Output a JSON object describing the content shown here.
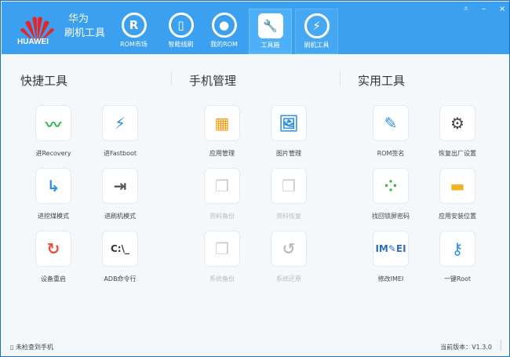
{
  "app": {
    "logo_text": "HUAWEI",
    "brand_line1": "华为",
    "brand_line2": "刷机工具"
  },
  "nav": [
    {
      "label": "ROM市场",
      "icon": "R"
    },
    {
      "label": "智能线刷",
      "icon": "▯"
    },
    {
      "label": "我的ROM",
      "icon": "●"
    },
    {
      "label": "工具箱",
      "icon": "🔧"
    },
    {
      "label": "刷机工具",
      "icon": "⚡"
    }
  ],
  "controls": {
    "menu": "⩡",
    "minimize": "–",
    "close": "×"
  },
  "sections": [
    {
      "title": "快捷工具",
      "items": [
        {
          "label": "进Recovery",
          "icon": "〰",
          "color": "#2ab54a"
        },
        {
          "label": "进Fastboot",
          "icon": "⚡",
          "color": "#2f8fe6"
        },
        {
          "label": "进挖煤模式",
          "icon": "↳",
          "color": "#2f8fe6"
        },
        {
          "label": "进刷机模式",
          "icon": "⇥",
          "color": "#555555"
        },
        {
          "label": "设备重启",
          "icon": "↻",
          "color": "#e8503a"
        },
        {
          "label": "ADB命令行",
          "icon": "C:\\_",
          "color": "#333333"
        }
      ]
    },
    {
      "title": "手机管理",
      "items": [
        {
          "label": "应用管理",
          "icon": "▦",
          "color": "#f39c12"
        },
        {
          "label": "图片管理",
          "icon": "🖼",
          "color": "#2f8fe6"
        },
        {
          "label": "资料备份",
          "icon": "❐",
          "color": "#cccccc",
          "disabled": true
        },
        {
          "label": "资料恢复",
          "icon": "❐",
          "color": "#cccccc",
          "disabled": true
        },
        {
          "label": "系统备份",
          "icon": "❐",
          "color": "#cccccc",
          "disabled": true
        },
        {
          "label": "系统还原",
          "icon": "↺",
          "color": "#bbbbbb",
          "disabled": true
        }
      ]
    },
    {
      "title": "实用工具",
      "items": [
        {
          "label": "ROM签名",
          "icon": "✎",
          "color": "#2f8fe6"
        },
        {
          "label": "恢复出厂设置",
          "icon": "⚙",
          "color": "#444444"
        },
        {
          "label": "找回锁屏密码",
          "icon": "⁘",
          "color": "#2ab54a"
        },
        {
          "label": "应用安装位置",
          "icon": "▬",
          "color": "#f3b321"
        },
        {
          "label": "修改IMEI",
          "icon": "IM✎EI",
          "color": "#2f6fc0"
        },
        {
          "label": "一键Root",
          "icon": "⚷",
          "color": "#2f8fe6"
        }
      ]
    }
  ],
  "status": {
    "device": "未检查到手机",
    "version": "当前版本：V1.3.0"
  }
}
